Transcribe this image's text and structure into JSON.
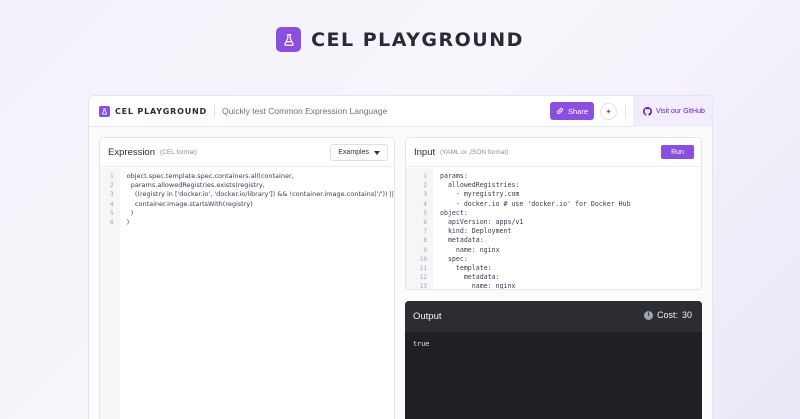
{
  "hero": {
    "title": "CEL PLAYGROUND"
  },
  "topbar": {
    "brand": "CEL PLAYGROUND",
    "subtitle": "Quickly test Common Expression Language",
    "share_label": "Share",
    "theme_icon": "sun-icon",
    "github_label": "Visit our GitHub"
  },
  "expression": {
    "title": "Expression",
    "subtitle": "(CEL format)",
    "examples_label": "Examples",
    "line_numbers": "1\n2\n3\n4\n5\n6",
    "code": "object.spec.template.spec.containers.all(container,\n  params.allowedRegistries.exists(registry,\n    ((registry in ['docker.io', 'docker.io/library']) && !container.image.contains('/')) ||\n    container.image.startsWith(registry)\n  )\n)"
  },
  "input": {
    "title": "Input",
    "subtitle": "(YAML or JSON format)",
    "run_label": "Run",
    "line_numbers": "1\n2\n3\n4\n5\n6\n7\n8\n9\n10\n11\n12\n13",
    "code": "params:\n  allowedRegistries:\n    - myregistry.com\n    - docker.io # use 'docker.io' for Docker Hub\nobject:\n  apiVersion: apps/v1\n  kind: Deployment\n  metadata:\n    name: nginx\n  spec:\n    template:\n      metadata:\n        name: nginx"
  },
  "output": {
    "title": "Output",
    "cost_label": "Cost:",
    "cost_value": "30",
    "result": "true"
  },
  "colors": {
    "accent": "#8b4fe0",
    "output_bg": "#1f2024"
  }
}
